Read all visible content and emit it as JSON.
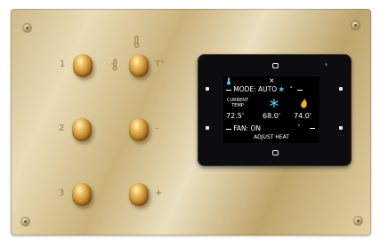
{
  "colors": {
    "brass": "#d9c89e",
    "panel": "#0d0d0f",
    "snowflake": "#4ec7f0",
    "flame": "#f0b429"
  },
  "plate": {
    "column_labels": {
      "left": [
        "1",
        "2",
        "3"
      ],
      "right_top": "T°",
      "right_middle": "–",
      "right_bottom": "+"
    },
    "icons": [
      "thermometer-icon",
      "thermometer-small-icon"
    ]
  },
  "display": {
    "close_symbol": "×",
    "mode": "MODE: AUTO",
    "current_label_line1": "CURRENT",
    "current_label_line2": "TEMP",
    "current_temp": "72.5'",
    "cool_setpoint": "68.0'",
    "heat_setpoint": "74.0'",
    "fan": "FAN: ON",
    "status": "ADJUST HEAT",
    "chevron_up": "˄",
    "chevron_down": "˅"
  }
}
